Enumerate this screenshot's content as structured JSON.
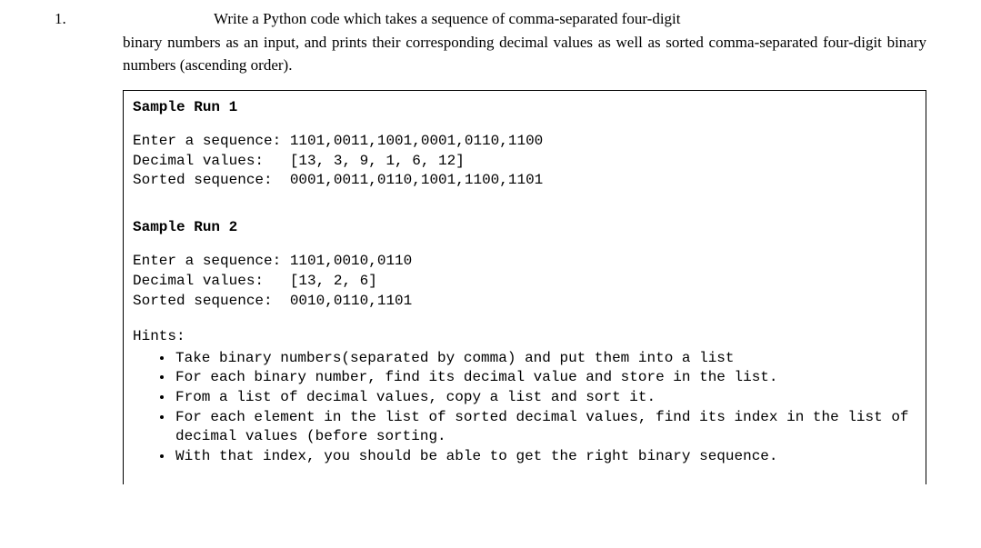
{
  "question": {
    "number": "1.",
    "text_line1": "Write a Python code which takes a sequence of comma-separated four-digit",
    "text_rest": "binary numbers as an input, and prints their corresponding decimal values as well as sorted comma-separated four-digit binary numbers (ascending order)."
  },
  "sample1": {
    "title": "Sample Run 1",
    "line1": "Enter a sequence: 1101,0011,1001,0001,0110,1100",
    "line2": "Decimal values:   [13, 3, 9, 1, 6, 12]",
    "line3": "Sorted sequence:  0001,0011,0110,1001,1100,1101"
  },
  "sample2": {
    "title": "Sample Run 2",
    "line1": "Enter a sequence: 1101,0010,0110",
    "line2": "Decimal values:   [13, 2, 6]",
    "line3": "Sorted sequence:  0010,0110,1101"
  },
  "hints": {
    "label": "Hints:",
    "items": [
      "Take binary numbers(separated by comma) and put them into a list",
      "For each binary number, find its decimal value and store in the list.",
      "From a list of decimal values, copy a list and sort it.",
      "For each element in the list of sorted decimal values, find its index in the list of decimal values (before sorting.",
      "With that index, you should be able to get the right binary sequence."
    ]
  }
}
